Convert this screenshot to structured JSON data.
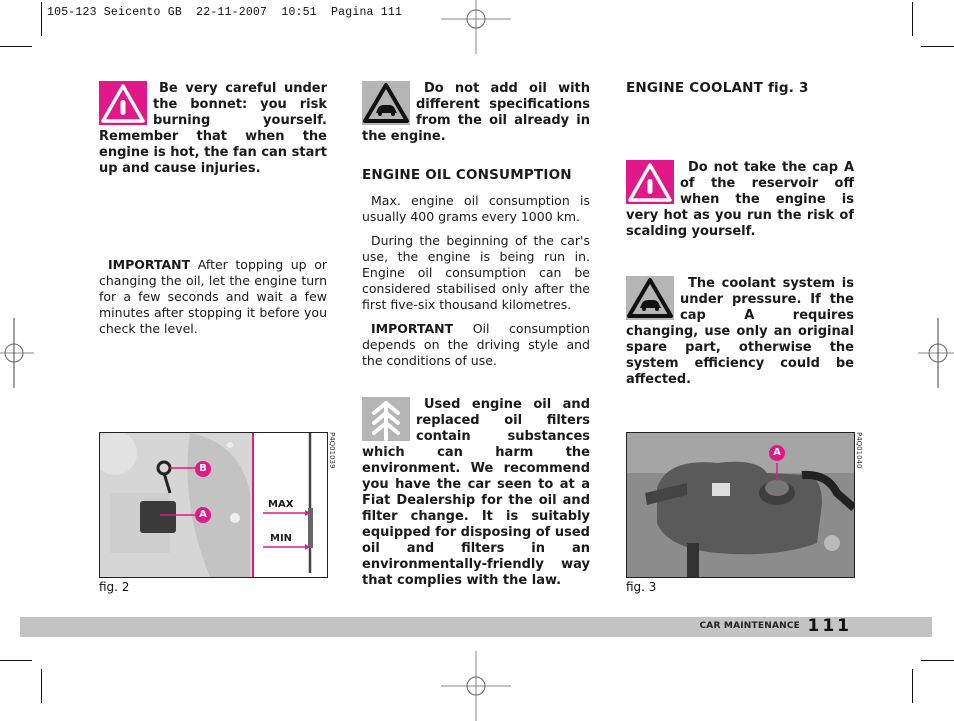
{
  "print_slug": "105-123 Seicento GB  22-11-2007  10:51  Pagina 111",
  "column1": {
    "warning": {
      "icon": "warning-triangle-icon",
      "text": "Be very careful under the bonnet: you risk burning yourself. Remember that when the engine is hot, the fan can start up and cause injuries."
    },
    "important": {
      "label": "IMPORTANT",
      "text": "After topping up or changing the oil, let the engine turn for a few seconds and wait a few minutes after stopping it before you check the level."
    },
    "figure": {
      "caption": "fig. 2",
      "code": "P4Q01039",
      "callouts": [
        "B",
        "A"
      ],
      "dipstick_labels": [
        "MAX",
        "MIN"
      ]
    }
  },
  "column2": {
    "caution": {
      "icon": "car-caution-icon",
      "text": "Do not add oil with different specifications from the oil already in the engine."
    },
    "heading": "ENGINE OIL CONSUMPTION",
    "paragraphs": [
      "Max. engine oil consumption is usually 400 grams every 1000 km.",
      "During the beginning of the car's use, the engine is being run in. Engine oil consumption can be considered stabilised only after the first five-six thousand kilometres."
    ],
    "important": {
      "label": "IMPORTANT",
      "text": "Oil consumption depends on the driving style and the conditions of use."
    },
    "environment": {
      "icon": "environment-tree-icon",
      "text": "Used engine oil and replaced oil filters contain substances which can harm the environment. We recommend you have the car seen to at a Fiat Dealership for the oil and filter change. It is suitably equipped for disposing of used oil and filters in an environmentally-friendly way that complies with the law."
    }
  },
  "column3": {
    "heading": "ENGINE COOLANT",
    "heading_ref": "fig. 3",
    "warning": {
      "icon": "warning-triangle-icon",
      "text": "Do not take the cap A of the reservoir off when the engine is very hot as you run the risk of scalding yourself."
    },
    "caution": {
      "icon": "car-caution-icon",
      "text": "The coolant system is under pressure. If the cap A requires changing, use only an original spare part, otherwise the system efficiency could be affected."
    },
    "figure": {
      "caption": "fig. 3",
      "code": "P4Q01040",
      "callouts": [
        "A"
      ]
    }
  },
  "footer": {
    "section": "CAR MAINTENANCE",
    "page_number": "111"
  },
  "colors": {
    "warning_pink": "#e0188a",
    "icon_grey": "#b5b5b5",
    "footer_bar": "#c4c4c4"
  }
}
